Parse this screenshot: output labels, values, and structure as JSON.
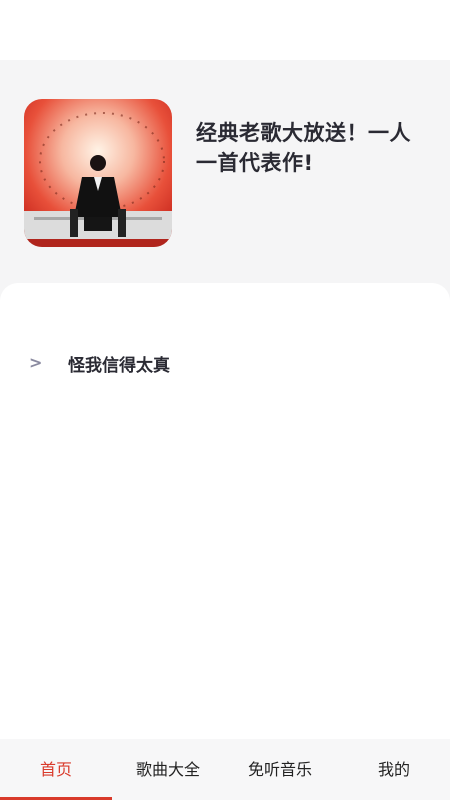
{
  "header": {
    "title": "经典老歌大放送！一人一首代表作!"
  },
  "album": {
    "icon": "album-cover-image"
  },
  "list": {
    "items": [
      {
        "chevron": ">",
        "title": "怪我信得太真"
      }
    ]
  },
  "tabs": [
    {
      "label": "首页",
      "active": true
    },
    {
      "label": "歌曲大全",
      "active": false
    },
    {
      "label": "免听音乐",
      "active": false
    },
    {
      "label": "我的",
      "active": false
    }
  ],
  "colors": {
    "accent": "#d93a2b",
    "header_bg": "#f5f5f6",
    "tabbar_bg": "#f7f7f8"
  }
}
